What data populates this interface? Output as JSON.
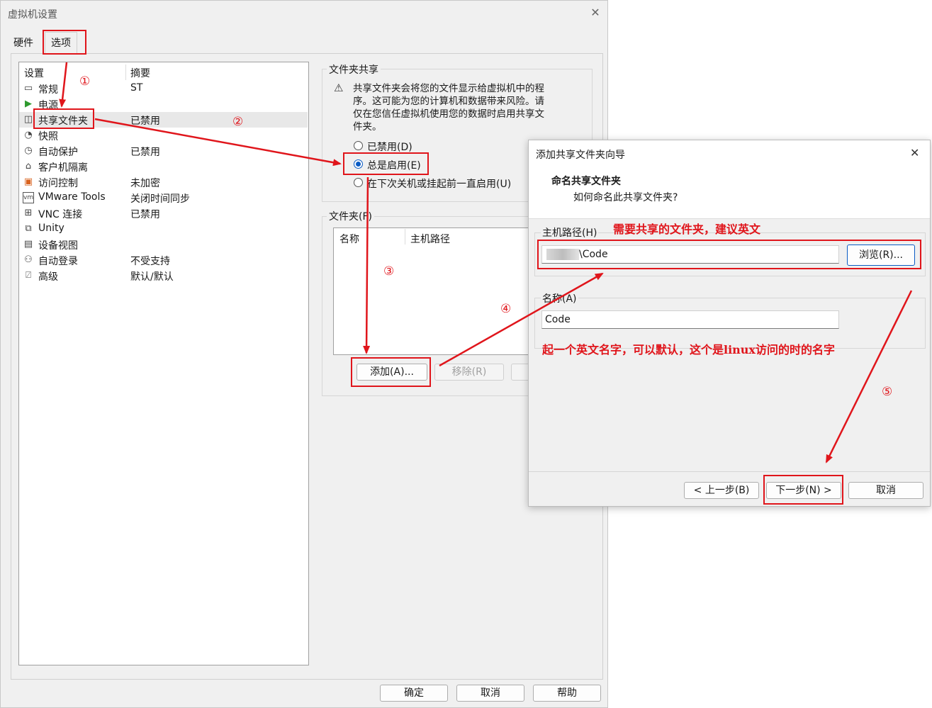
{
  "main": {
    "title": "虚拟机设置",
    "close_glyph": "✕",
    "tabs": [
      {
        "label": "硬件"
      },
      {
        "label": "选项"
      }
    ],
    "list": {
      "col_setting": "设置",
      "col_summary": "摘要",
      "items": [
        {
          "label": "常规",
          "summary": "ST",
          "icon": "monitor-icon"
        },
        {
          "label": "电源",
          "summary": "",
          "icon": "play-icon"
        },
        {
          "label": "共享文件夹",
          "summary": "已禁用",
          "icon": "folder-share-icon"
        },
        {
          "label": "快照",
          "summary": "",
          "icon": "snapshot-icon"
        },
        {
          "label": "自动保护",
          "summary": "已禁用",
          "icon": "clock-icon"
        },
        {
          "label": "客户机隔离",
          "summary": "",
          "icon": "lock-icon"
        },
        {
          "label": "访问控制",
          "summary": "未加密",
          "icon": "access-icon"
        },
        {
          "label": "VMware Tools",
          "summary": "关闭时间同步",
          "icon": "vm-icon"
        },
        {
          "label": "VNC 连接",
          "summary": "已禁用",
          "icon": "network-icon"
        },
        {
          "label": "Unity",
          "summary": "",
          "icon": "unity-icon"
        },
        {
          "label": "设备视图",
          "summary": "",
          "icon": "device-view-icon"
        },
        {
          "label": "自动登录",
          "summary": "不受支持",
          "icon": "user-icon"
        },
        {
          "label": "高级",
          "summary": "默认/默认",
          "icon": "advanced-icon"
        }
      ]
    },
    "sharing": {
      "group_title": "文件夹共享",
      "warning": "共享文件夹会将您的文件显示给虚拟机中的程序。这可能为您的计算机和数据带来风险。请仅在您信任虚拟机使用您的数据时启用共享文件夹。",
      "options": [
        {
          "label": "已禁用(D)",
          "checked": false
        },
        {
          "label": "总是启用(E)",
          "checked": true
        },
        {
          "label": "在下次关机或挂起前一直启用(U)",
          "checked": false
        }
      ]
    },
    "folders": {
      "group_title": "文件夹(F)",
      "col_name": "名称",
      "col_path": "主机路径",
      "add_label": "添加(A)...",
      "remove_label": "移除(R)"
    },
    "footer": {
      "ok": "确定",
      "cancel": "取消",
      "help": "帮助"
    }
  },
  "wizard": {
    "title": "添加共享文件夹向导",
    "close_glyph": "✕",
    "heading": "命名共享文件夹",
    "subheading": "如何命名此共享文件夹?",
    "host_path_label": "主机路径(H)",
    "host_path_value": "\\Code",
    "browse_label": "浏览(R)...",
    "name_label": "名称(A)",
    "name_value": "Code",
    "back_label": "< 上一步(B)",
    "next_label": "下一步(N) >",
    "cancel_label": "取消"
  },
  "annotations": {
    "step1": "①",
    "step2": "②",
    "step3": "③",
    "step4": "④",
    "step5": "⑤",
    "note_path": "需要共享的文件夹，建议英文",
    "note_name": "起一个英文名字，可以默认，这个是linux访问的时的名字",
    "color": "#e0151b"
  }
}
